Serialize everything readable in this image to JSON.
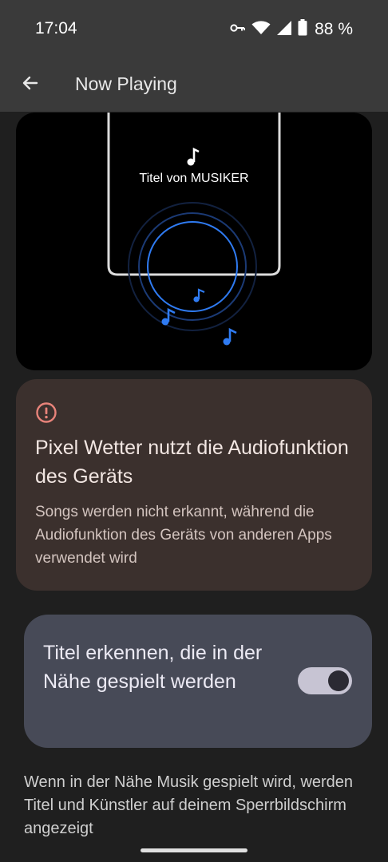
{
  "status_bar": {
    "time": "17:04",
    "battery_text": "88 %",
    "icons": [
      "vpn-key-icon",
      "wifi-icon",
      "signal-icon",
      "battery-icon"
    ]
  },
  "app_bar": {
    "title": "Now Playing",
    "back_icon": "arrow-back-icon"
  },
  "illustration": {
    "song_title": "Titel von MUSIKER",
    "icons": [
      "music-note-icon"
    ]
  },
  "warning_card": {
    "icon": "error-outline-icon",
    "title": "Pixel Wetter nutzt die Audiofunktion des Geräts",
    "body": "Songs werden nicht erkannt, während die Audiofunktion des Geräts von anderen Apps verwendet wird"
  },
  "toggle_card": {
    "label": "Titel erkennen, die in der Nähe gespielt werden",
    "toggle_on": true
  },
  "footer": {
    "description": "Wenn in der Nähe Musik gespielt wird, werden Titel und Künstler auf deinem Sperrbildschirm angezeigt"
  },
  "colors": {
    "background": "#1f1f1f",
    "app_bar": "#3a3a3a",
    "warning_card_bg": "#3b302d",
    "warning_icon": "#e8837a",
    "toggle_card_bg": "#474a57",
    "switch_track": "#c7c4d3",
    "accent_blue": "#2f7bf2"
  }
}
